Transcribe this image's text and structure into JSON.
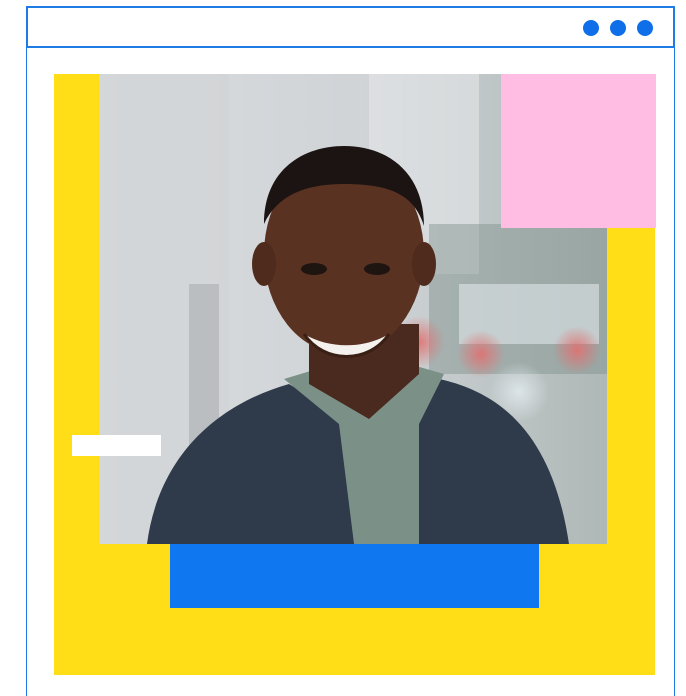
{
  "window": {
    "title_dots": [
      "dot-1",
      "dot-2",
      "dot-3"
    ],
    "dot_color": "#0f6fe8",
    "frame_color": "#1f7be6"
  },
  "illustration": {
    "photo_description_icon": "portrait-photo",
    "colors": {
      "yellow": "#ffde17",
      "pink": "#ffbde3",
      "blue": "#0f77f0",
      "white": "#ffffff"
    }
  }
}
